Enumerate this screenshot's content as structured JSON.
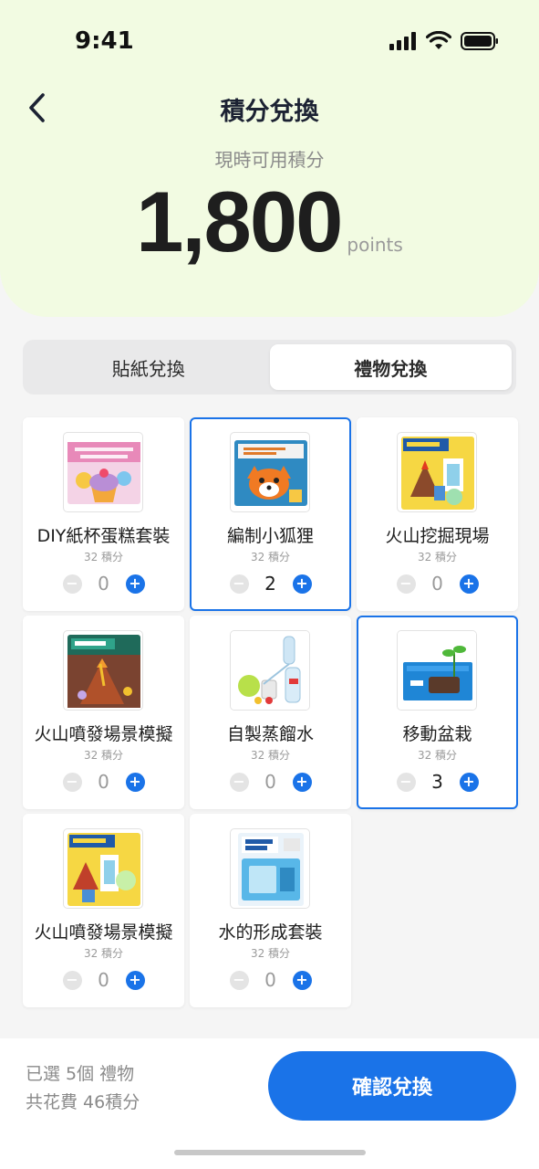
{
  "status_bar": {
    "time": "9:41"
  },
  "header": {
    "title": "積分兌換",
    "points_label": "現時可用積分",
    "points_value": "1,800",
    "points_unit": "points"
  },
  "tabs": [
    {
      "label": "貼紙兌換",
      "active": false
    },
    {
      "label": "禮物兌換",
      "active": true
    }
  ],
  "items": [
    {
      "name": "DIY紙杯蛋糕套裝",
      "cost": "32 積分",
      "qty": "0",
      "selected": false,
      "icon": "cupcake-kit-image"
    },
    {
      "name": "編制小狐狸",
      "cost": "32 積分",
      "qty": "2",
      "selected": true,
      "icon": "fox-doll-kit-image"
    },
    {
      "name": "火山挖掘現場",
      "cost": "32 積分",
      "qty": "0",
      "selected": false,
      "icon": "volcano-dig-kit-image"
    },
    {
      "name": "火山噴發場景模擬",
      "cost": "32 積分",
      "qty": "0",
      "selected": false,
      "icon": "volcano-crystal-kit-image"
    },
    {
      "name": "自製蒸餾水",
      "cost": "32 積分",
      "qty": "0",
      "selected": false,
      "icon": "distilled-water-kit-image"
    },
    {
      "name": "移動盆栽",
      "cost": "32 積分",
      "qty": "3",
      "selected": true,
      "icon": "moving-plant-kit-image"
    },
    {
      "name": "火山噴發場景模擬",
      "cost": "32 積分",
      "qty": "0",
      "selected": false,
      "icon": "volcano-science-kit-image"
    },
    {
      "name": "水的形成套裝",
      "cost": "32 積分",
      "qty": "0",
      "selected": false,
      "icon": "water-clock-kit-image"
    }
  ],
  "footer": {
    "selected_text": "已選 5個 禮物",
    "cost_text": "共花費 46積分",
    "confirm_label": "確認兌換"
  },
  "colors": {
    "accent": "#1a73e8",
    "header_bg": "#f2fbe2",
    "page_bg": "#f5f5f5"
  }
}
